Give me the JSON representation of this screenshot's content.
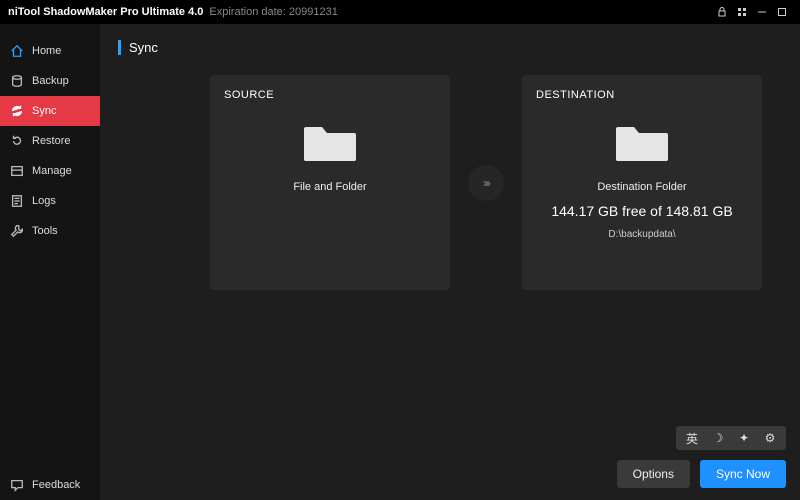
{
  "titlebar": {
    "app_title": "niTool ShadowMaker Pro Ultimate 4.0",
    "expiration_prefix": "Expiration date: ",
    "expiration_value": "20991231"
  },
  "sidebar": {
    "items": [
      {
        "label": "Home"
      },
      {
        "label": "Backup"
      },
      {
        "label": "Sync"
      },
      {
        "label": "Restore"
      },
      {
        "label": "Manage"
      },
      {
        "label": "Logs"
      },
      {
        "label": "Tools"
      }
    ],
    "feedback_label": "Feedback"
  },
  "page": {
    "title": "Sync"
  },
  "source": {
    "heading": "SOURCE",
    "caption": "File and Folder"
  },
  "destination": {
    "heading": "DESTINATION",
    "caption": "Destination Folder",
    "free_space": "144.17 GB free of 148.81 GB",
    "path": "D:\\backupdata\\"
  },
  "arrow_glyph": "›››",
  "tray": {
    "lang_glyph": "英",
    "moon_glyph": "☽",
    "wand_glyph": "✦",
    "gear_glyph": "⚙"
  },
  "footer": {
    "options_label": "Options",
    "sync_now_label": "Sync Now"
  }
}
